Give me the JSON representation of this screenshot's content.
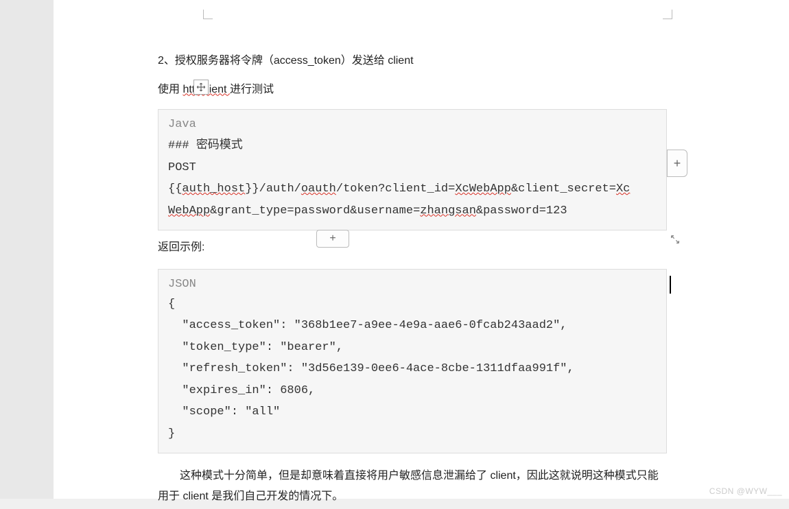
{
  "doc": {
    "line1_prefix": "2、授权服务器将令牌（",
    "line1_token": "access_token",
    "line1_suffix": "）发送给 client",
    "line2_prefix": "使用 ",
    "line2_link": "httpclient ",
    "line2_suffix": "进行测试"
  },
  "code1": {
    "lang": "Java",
    "l1_a": "### ",
    "l1_b": "密码模式",
    "l2": "POST",
    "l3_a": "{{",
    "l3_b": "auth_host",
    "l3_c": "}}/auth/",
    "l3_d": "oauth",
    "l3_e": "/token?client_id=",
    "l3_f": "XcWebApp",
    "l3_g": "&client_secret=",
    "l3_h": "Xc",
    "l4_a": "WebApp",
    "l4_b": "&grant_type=password&username=",
    "l4_c": "zhangsan",
    "l4_d": "&password=123"
  },
  "return_label": "返回示例:",
  "code2": {
    "lang": "JSON",
    "l1": "{",
    "l2": "  \"access_token\": \"368b1ee7-a9ee-4e9a-aae6-0fcab243aad2\",",
    "l3": "  \"token_type\": \"bearer\",",
    "l4": "  \"refresh_token\": \"3d56e139-0ee6-4ace-8cbe-1311dfaa991f\",",
    "l5": "  \"expires_in\": 6806,",
    "l6": "  \"scope\": \"all\"",
    "l7": "}"
  },
  "para_bottom": "这种模式十分简单，但是却意味着直接将用户敏感信息泄漏给了 client，因此这就说明这种模式只能用于 client 是我们自己开发的情况下。",
  "watermark": "CSDN @WYW___"
}
